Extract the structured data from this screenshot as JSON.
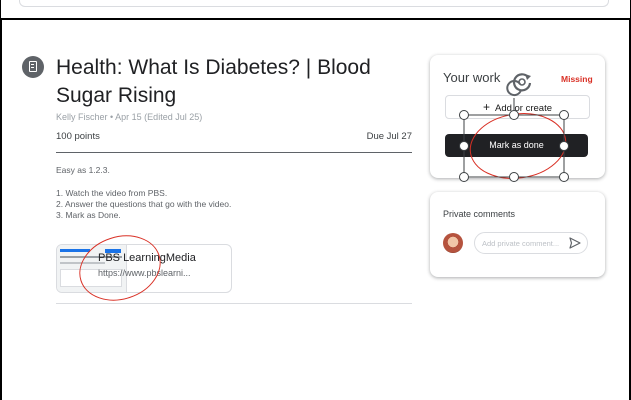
{
  "assignment": {
    "icon": "assignment-icon",
    "title": "Health: What Is Diabetes? | Blood Sugar Rising",
    "meta": "Kelly Fischer • Apr 15 (Edited Jul 25)",
    "points": "100 points",
    "due": "Due Jul 27",
    "description": [
      "Easy as 1.2.3.",
      "",
      "1. Watch the video from PBS.",
      "2. Answer the questions that go with the video.",
      "3. Mark as Done."
    ],
    "attachment": {
      "title": "PBS LearningMedia",
      "url": "https://www.pbslearni..."
    }
  },
  "your_work": {
    "title": "Your work",
    "status": "Missing",
    "add_label": "Add or create",
    "done_label": "Mark as done"
  },
  "comments": {
    "title": "Private comments",
    "placeholder": "Add private comment..."
  },
  "colors": {
    "missing": "#d93025",
    "done_button": "#202124",
    "annotation": "#d93025",
    "accent": "#1a73e8"
  }
}
